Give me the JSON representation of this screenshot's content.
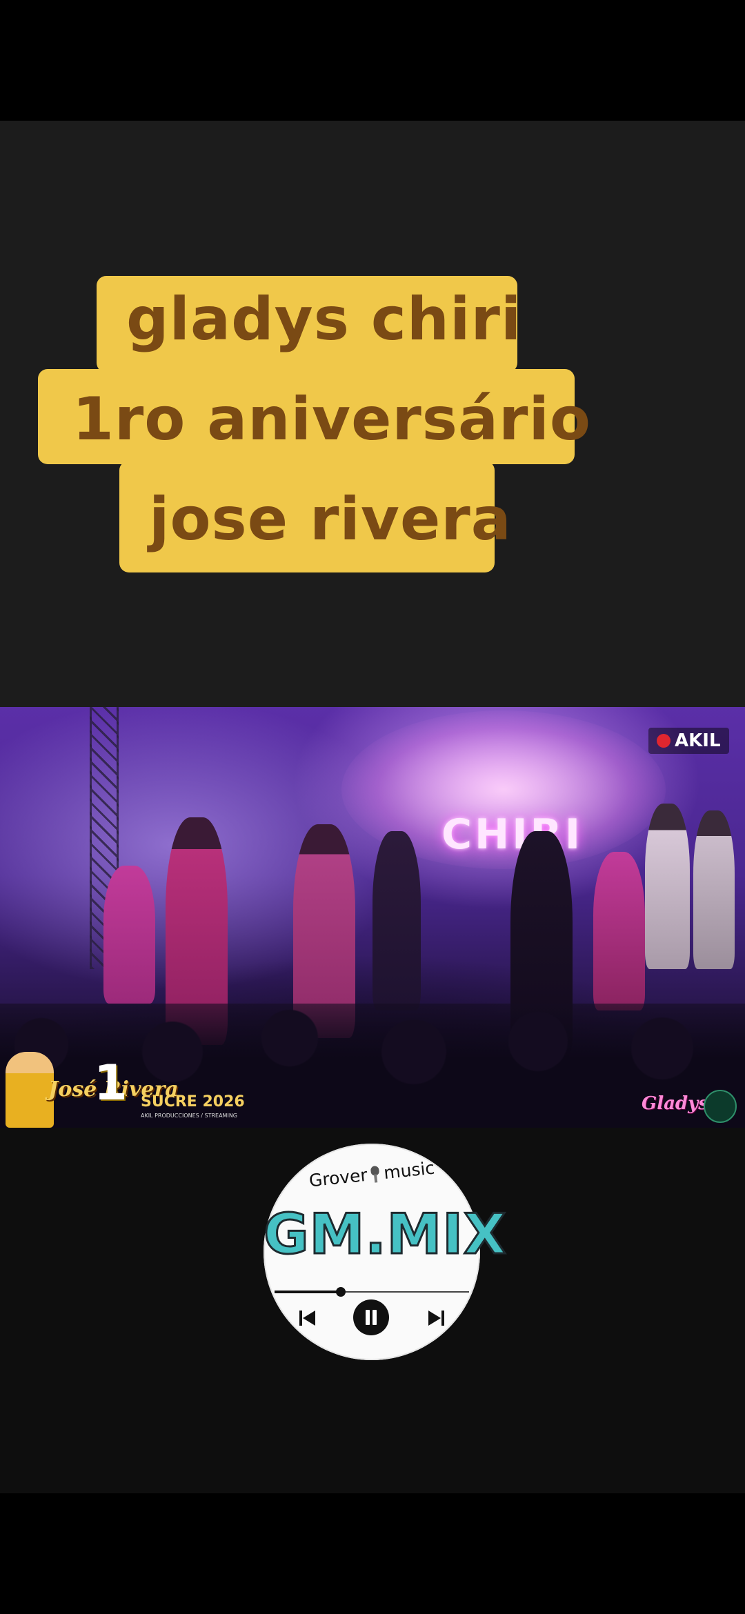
{
  "caption": {
    "lines": [
      "gladys chiri",
      "1ro aniversário",
      "jose rivera"
    ],
    "bg_color": "#f0c84a",
    "text_color": "#7a4a14"
  },
  "video": {
    "stage_sign_text": "CHIRI",
    "channel_badge": "AKIL",
    "overlay": {
      "artist_name": "José Rivera",
      "anniversary_number": "1",
      "event": "SUCRE 2026",
      "producer": "AKIL PRODUCCIONES / STREAMING",
      "right_logo": "Gladys"
    }
  },
  "player": {
    "brand_top_left": "Grover",
    "brand_top_right": "music",
    "brand_main": "GM.MIX",
    "brand_color": "#46c1c4",
    "progress": 0.34,
    "controls": {
      "prev_icon": "skip-previous-icon",
      "play_pause_icon": "pause-icon",
      "next_icon": "skip-next-icon"
    }
  }
}
